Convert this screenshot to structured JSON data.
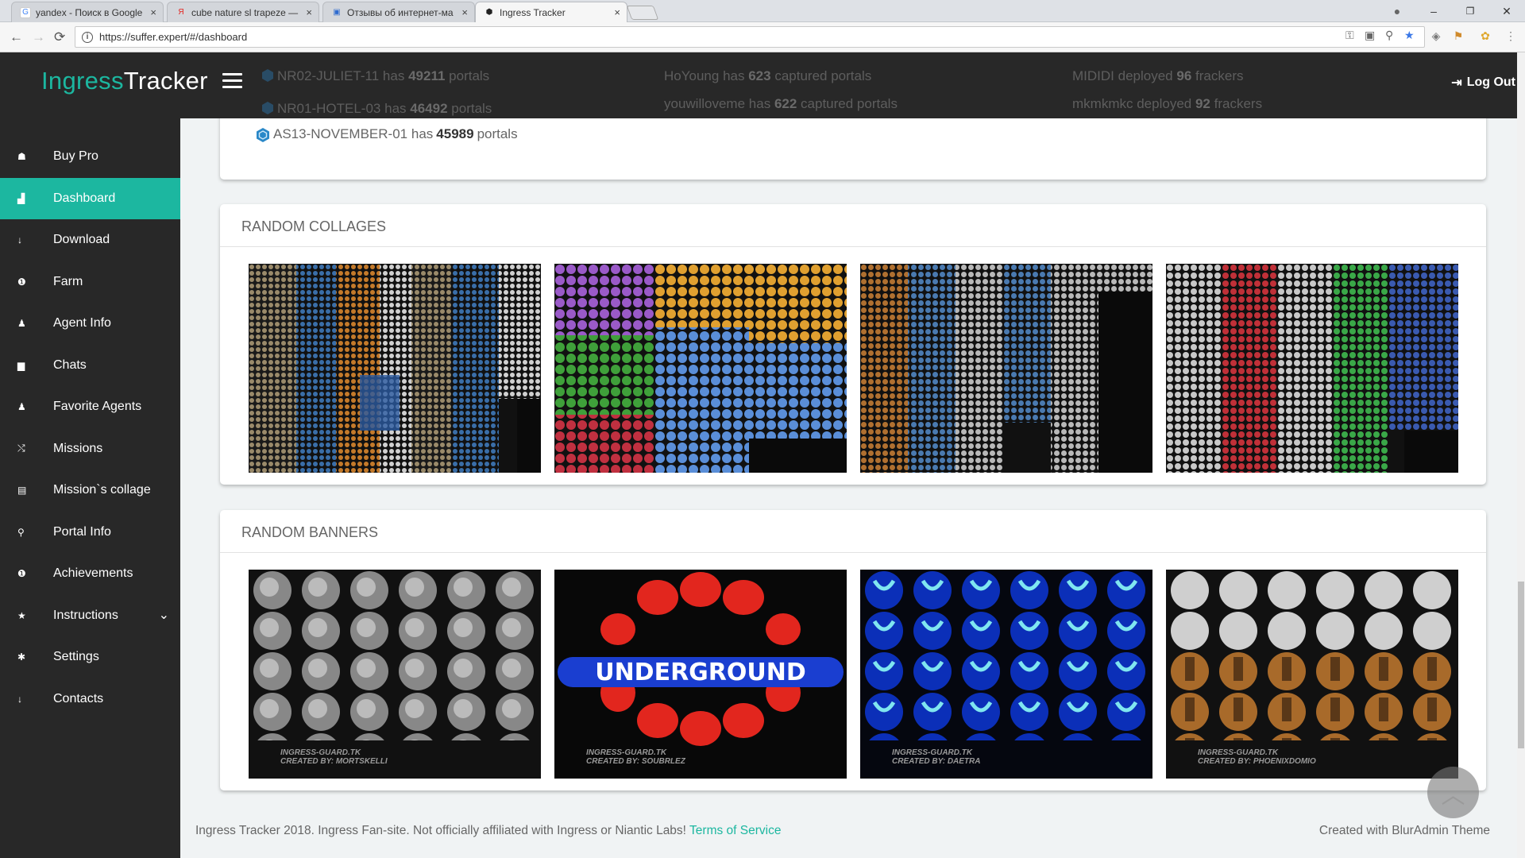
{
  "browser": {
    "tabs": [
      {
        "title": "yandex - Поиск в Google",
        "close": "×",
        "favicon_color": "#4285f4",
        "favicon_text": "G"
      },
      {
        "title": "cube nature sl trapeze —",
        "close": "×",
        "favicon_color": "#e4241f",
        "favicon_text": "Я"
      },
      {
        "title": "Отзывы об интернет-ма",
        "close": "×",
        "favicon_color": "#2f6bcf",
        "favicon_text": "▣"
      },
      {
        "title": "Ingress Tracker",
        "close": "×",
        "favicon_color": "#222222",
        "favicon_text": "⬢"
      }
    ],
    "window_controls": {
      "account": "●",
      "minimize": "–",
      "maximize": "❐",
      "close": "✕"
    },
    "nav": {
      "back": "←",
      "forward": "→",
      "reload": "⟳"
    },
    "url": "https://suffer.expert/#/dashboard",
    "info": "i"
  },
  "app": {
    "logo_a": "Ingress",
    "logo_b": "Tracker",
    "logout": "Log Out",
    "logout_icon": "⇥"
  },
  "behind_header": {
    "portals": [
      {
        "name": "NR02-JULIET-11",
        "mid": "has",
        "count": "49211",
        "tail": "portals"
      },
      {
        "name": "NR01-HOTEL-03",
        "mid": "has",
        "count": "46492",
        "tail": "portals"
      }
    ],
    "captured": [
      {
        "name": "HoYoung",
        "mid": "has",
        "count": "623",
        "tail": "captured portals"
      },
      {
        "name": "youwilloveme",
        "mid": "has",
        "count": "622",
        "tail": "captured portals"
      }
    ],
    "frackers": [
      {
        "name": "MIDIDI",
        "mid": "deployed",
        "count": "96",
        "tail": "frackers"
      },
      {
        "name": "mkmkmkc",
        "mid": "deployed",
        "count": "92",
        "tail": "frackers"
      }
    ]
  },
  "sidebar": {
    "items": [
      {
        "label": "Buy Pro",
        "icon": "☗"
      },
      {
        "label": "Dashboard",
        "icon": "▟",
        "active": true
      },
      {
        "label": "Download",
        "icon": "↓"
      },
      {
        "label": "Farm",
        "icon": "❶"
      },
      {
        "label": "Agent Info",
        "icon": "♟"
      },
      {
        "label": "Chats",
        "icon": "▆"
      },
      {
        "label": "Favorite Agents",
        "icon": "♟"
      },
      {
        "label": "Missions",
        "icon": "⤭"
      },
      {
        "label": "Mission`s collage",
        "icon": "▤"
      },
      {
        "label": "Portal Info",
        "icon": "⚲"
      },
      {
        "label": "Achievements",
        "icon": "❶"
      },
      {
        "label": "Instructions",
        "icon": "★",
        "chevron": "⌄"
      },
      {
        "label": "Settings",
        "icon": "✱"
      },
      {
        "label": "Contacts",
        "icon": "↓"
      }
    ]
  },
  "top_portals_last": {
    "name": "AS13-NOVEMBER-01",
    "mid": "has",
    "count": "45989",
    "tail": "portals"
  },
  "collages": {
    "title": "RANDOM COLLAGES",
    "items": [
      "collage-1",
      "collage-2",
      "collage-3",
      "collage-4"
    ]
  },
  "banners": {
    "title": "RANDOM BANNERS",
    "items": [
      {
        "caption1": "INGRESS-GUARD.TK",
        "caption2": "CREATED BY: MORTSKELLI"
      },
      {
        "caption1": "INGRESS-GUARD.TK",
        "caption2": "CREATED BY: SOUBRLEZ",
        "text": "UNDERGROUND"
      },
      {
        "caption1": "INGRESS-GUARD.TK",
        "caption2": "CREATED BY: DAETRA"
      },
      {
        "caption1": "INGRESS-GUARD.TK",
        "caption2": "CREATED BY: PHOENIXDOMIO"
      }
    ]
  },
  "footer": {
    "text": "Ingress Tracker 2018. Ingress Fan-site. Not officially affiliated with Ingress or Niantic Labs!",
    "tos": "Terms of Service",
    "right": "Created with BlurAdmin Theme"
  },
  "scroll_top_icon": "︿",
  "colors": {
    "accent": "#1cb7a0",
    "nav_bg": "#282828",
    "page_bg": "#f0f3f4"
  }
}
